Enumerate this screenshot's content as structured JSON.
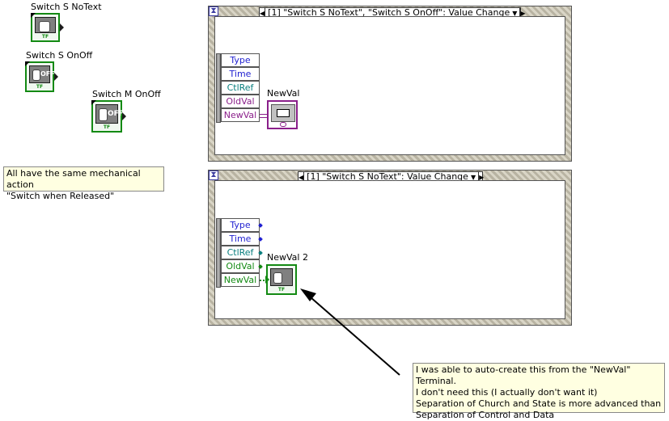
{
  "controls": [
    {
      "label": "Switch S NoText",
      "variant": "notext"
    },
    {
      "label": "Switch S OnOff",
      "variant": "onoff",
      "switch_text": "OFF"
    },
    {
      "label": "Switch M OnOff",
      "variant": "onoff",
      "switch_text": "OFF"
    }
  ],
  "terminal_badge": "TF",
  "comment_mechanical": {
    "line1": "All have the same mechanical action",
    "line2": "\"Switch when Released\""
  },
  "event_structure_1": {
    "selector": "[1] \"Switch S NoText\", \"Switch S OnOff\": Value Change",
    "fields": [
      "Type",
      "Time",
      "CtlRef",
      "OldVal",
      "NewVal"
    ],
    "indicator_label": "NewVal"
  },
  "event_structure_2": {
    "selector": "[1] \"Switch S NoText\": Value Change",
    "fields": [
      "Type",
      "Time",
      "CtlRef",
      "OldVal",
      "NewVal"
    ],
    "indicator_label": "NewVal 2"
  },
  "comment_autocreate": {
    "line1": "I was able to auto-create this from the \"NewVal\" Terminal.",
    "line2": "I don't need this (I actually don't want it)",
    "line3": "Separation of Church and State is more advanced than",
    "line4": "Separation of Control and Data"
  },
  "colors": {
    "boolean_wire": "#138a13",
    "variant_wire": "#8a1f8a",
    "enum_text": "#1f1fd0"
  }
}
